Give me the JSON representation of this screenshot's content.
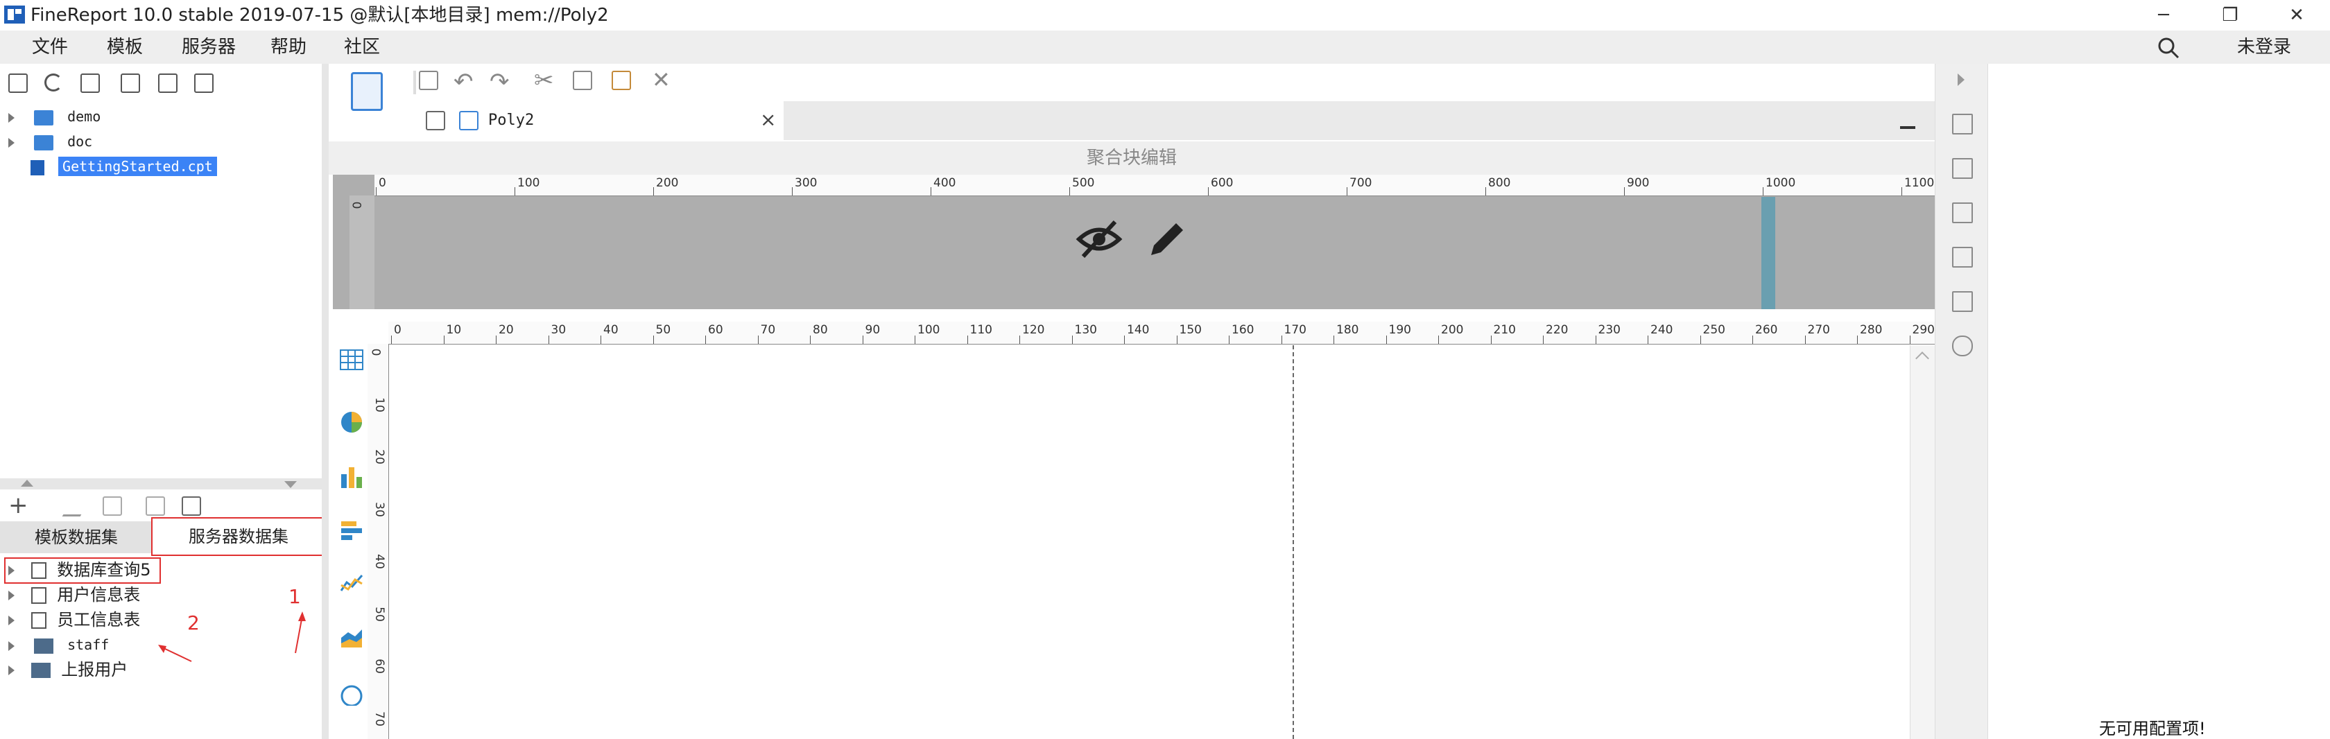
{
  "window": {
    "title": "FineReport 10.0 stable 2019-07-15 @默认[本地目录]   mem://Poly2",
    "minimize_glyph": "─",
    "restore_glyph": "❐",
    "close_glyph": "✕"
  },
  "menubar": {
    "items": [
      "文件",
      "模板",
      "服务器",
      "帮助",
      "社区"
    ],
    "login_label": "未登录",
    "search_icon": "search-icon"
  },
  "file_tree": {
    "items": [
      {
        "label": "demo",
        "type": "folder"
      },
      {
        "label": "doc",
        "type": "folder"
      },
      {
        "label": "GettingStarted.cpt",
        "type": "file",
        "selected": true
      }
    ]
  },
  "dataset_panel": {
    "tabs": [
      "模板数据集",
      "服务器数据集"
    ],
    "items": [
      {
        "label": "数据库查询5",
        "icon": "database-query-icon"
      },
      {
        "label": "用户信息表",
        "icon": "database-query-icon"
      },
      {
        "label": "员工信息表",
        "icon": "database-query-icon"
      },
      {
        "label": "staff",
        "icon": "table-icon"
      },
      {
        "label": "上报用户",
        "icon": "table-icon"
      }
    ],
    "annotations": [
      "1",
      "2"
    ]
  },
  "editor": {
    "tab_label": "Poly2",
    "tab_close": "×",
    "block_title": "聚合块编辑",
    "top_ruler_ticks": [
      "0",
      "100",
      "200",
      "300",
      "400",
      "500",
      "600",
      "700",
      "800",
      "900",
      "1000",
      "1100"
    ],
    "top_vruler_ticks": [
      "0"
    ],
    "main_ruler_ticks": [
      "0",
      "10",
      "20",
      "30",
      "40",
      "50",
      "60",
      "70",
      "80",
      "90",
      "100",
      "110",
      "120",
      "130",
      "140",
      "150",
      "160",
      "170",
      "180",
      "190",
      "200",
      "210",
      "220",
      "230",
      "240",
      "250",
      "260",
      "270",
      "280",
      "290"
    ],
    "main_vruler_ticks": [
      "0",
      "10",
      "20",
      "30",
      "40",
      "50",
      "60",
      "70"
    ]
  },
  "right_panel": {
    "empty_text": "无可用配置项!"
  },
  "colors": {
    "accent": "#3b83d6",
    "selected_bg": "#3b83f6",
    "annotation": "#e03030"
  }
}
